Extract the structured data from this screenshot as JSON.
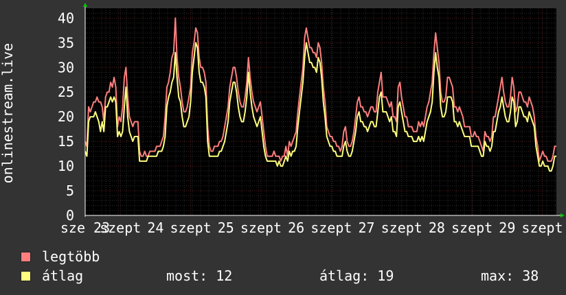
{
  "chart_data": {
    "type": "line",
    "ylabel": "onlinestream.live",
    "ylim": [
      0,
      42
    ],
    "y_ticks": [
      0,
      5,
      10,
      15,
      20,
      25,
      30,
      35,
      40
    ],
    "x_tick_labels": [
      "sze 23",
      "szept",
      "24",
      "szept",
      "25",
      "szept",
      "26",
      "szept",
      "27",
      "szept",
      "28",
      "szept",
      "29",
      "szept"
    ],
    "grid": true,
    "colors": {
      "background": "#000000",
      "page": "#333333",
      "grid_major": "#5a2222",
      "grid_minor": "#2c2c2c",
      "legtobb": "#ff7f7f",
      "atlag": "#ffff7f",
      "axis": "#ffffff",
      "arrow": "#00cc00"
    },
    "series": [
      {
        "name": "legtöbb",
        "values": [
          15,
          14,
          22,
          21,
          22,
          23,
          23,
          24,
          23,
          23,
          22,
          19,
          24,
          25,
          25,
          27,
          26,
          28,
          26,
          18,
          20,
          19,
          22,
          28,
          30,
          24,
          20,
          19,
          18,
          19,
          19,
          19,
          13,
          12,
          12,
          13,
          12,
          12,
          13,
          13,
          13,
          13,
          14,
          14,
          14,
          15,
          16,
          20,
          26,
          27,
          29,
          32,
          33,
          40,
          32,
          28,
          26,
          23,
          21,
          21,
          22,
          24,
          26,
          33,
          35,
          38,
          37,
          32,
          30,
          30,
          29,
          27,
          18,
          14,
          13,
          13,
          14,
          14,
          14,
          15,
          15,
          16,
          18,
          20,
          22,
          26,
          28,
          30,
          30,
          28,
          25,
          23,
          22,
          22,
          24,
          27,
          32,
          28,
          25,
          23,
          22,
          21,
          22,
          23,
          20,
          17,
          14,
          12,
          12,
          12,
          12,
          13,
          12,
          12,
          12,
          11,
          12,
          12,
          14,
          12,
          15,
          14,
          15,
          16,
          17,
          21,
          24,
          27,
          30,
          36,
          38,
          36,
          34,
          34,
          33,
          33,
          32,
          35,
          34,
          31,
          26,
          23,
          18,
          17,
          16,
          16,
          15,
          15,
          14,
          14,
          13,
          14,
          17,
          18,
          15,
          14,
          14,
          15,
          17,
          20,
          23,
          24,
          22,
          22,
          21,
          21,
          20,
          21,
          22,
          22,
          21,
          21,
          25,
          27,
          29,
          24,
          24,
          24,
          23,
          22,
          23,
          20,
          20,
          19,
          26,
          27,
          24,
          22,
          20,
          20,
          18,
          18,
          18,
          17,
          17,
          17,
          19,
          18,
          19,
          18,
          20,
          22,
          23,
          25,
          27,
          33,
          37,
          34,
          31,
          25,
          23,
          23,
          24,
          28,
          28,
          27,
          26,
          22,
          22,
          21,
          22,
          21,
          20,
          18,
          18,
          18,
          18,
          16,
          16,
          17,
          16,
          16,
          15,
          14,
          13,
          17,
          16,
          16,
          15,
          16,
          20,
          20,
          22,
          24,
          26,
          28,
          25,
          23,
          22,
          22,
          24,
          28,
          26,
          21,
          22,
          25,
          25,
          24,
          23,
          23,
          22,
          24,
          23,
          22,
          20,
          16,
          14,
          11,
          12,
          13,
          12,
          12,
          11,
          11,
          11,
          12,
          14,
          14
        ]
      },
      {
        "name": "átlag",
        "values": [
          13,
          12,
          19,
          20,
          20,
          20,
          21,
          20,
          19,
          17,
          19,
          17,
          22,
          22,
          23,
          24,
          23,
          24,
          23,
          16,
          17,
          16,
          17,
          22,
          26,
          20,
          17,
          16,
          15,
          16,
          16,
          16,
          11,
          11,
          11,
          11,
          11,
          12,
          12,
          12,
          12,
          12,
          12,
          13,
          13,
          13,
          14,
          16,
          22,
          24,
          25,
          27,
          28,
          33,
          28,
          24,
          23,
          20,
          18,
          18,
          19,
          20,
          23,
          29,
          32,
          35,
          34,
          29,
          27,
          27,
          26,
          24,
          15,
          12,
          12,
          12,
          12,
          12,
          12,
          13,
          13,
          14,
          15,
          17,
          19,
          23,
          25,
          27,
          27,
          25,
          22,
          20,
          19,
          19,
          21,
          24,
          29,
          25,
          22,
          20,
          19,
          18,
          19,
          20,
          17,
          14,
          12,
          11,
          11,
          11,
          11,
          11,
          11,
          10,
          11,
          10,
          10,
          11,
          12,
          11,
          13,
          12,
          13,
          13,
          14,
          18,
          21,
          24,
          27,
          32,
          35,
          33,
          31,
          31,
          30,
          30,
          29,
          32,
          31,
          28,
          23,
          20,
          16,
          15,
          14,
          14,
          13,
          13,
          12,
          12,
          12,
          12,
          14,
          15,
          13,
          12,
          12,
          13,
          15,
          17,
          20,
          21,
          19,
          19,
          18,
          18,
          17,
          18,
          19,
          19,
          18,
          18,
          21,
          24,
          25,
          21,
          21,
          21,
          20,
          19,
          20,
          17,
          17,
          16,
          22,
          23,
          21,
          19,
          17,
          17,
          16,
          16,
          16,
          15,
          15,
          15,
          16,
          15,
          16,
          15,
          17,
          19,
          20,
          21,
          23,
          29,
          33,
          30,
          28,
          22,
          20,
          20,
          21,
          24,
          24,
          24,
          23,
          19,
          19,
          18,
          19,
          18,
          17,
          16,
          16,
          16,
          16,
          14,
          14,
          14,
          14,
          14,
          13,
          12,
          12,
          15,
          14,
          14,
          13,
          14,
          17,
          17,
          19,
          21,
          22,
          24,
          22,
          20,
          19,
          19,
          21,
          24,
          23,
          18,
          19,
          22,
          22,
          21,
          20,
          20,
          19,
          21,
          20,
          19,
          18,
          14,
          12,
          10,
          10,
          11,
          10,
          10,
          10,
          9,
          9,
          10,
          12,
          12
        ]
      }
    ]
  },
  "legend": [
    {
      "label": "legtöbb",
      "color": "#ff7f7f"
    },
    {
      "label": "átlag",
      "color": "#ffff7f"
    }
  ],
  "stats": {
    "most": "most: 12",
    "atlag": "átlag: 19",
    "max": "max: 38"
  }
}
